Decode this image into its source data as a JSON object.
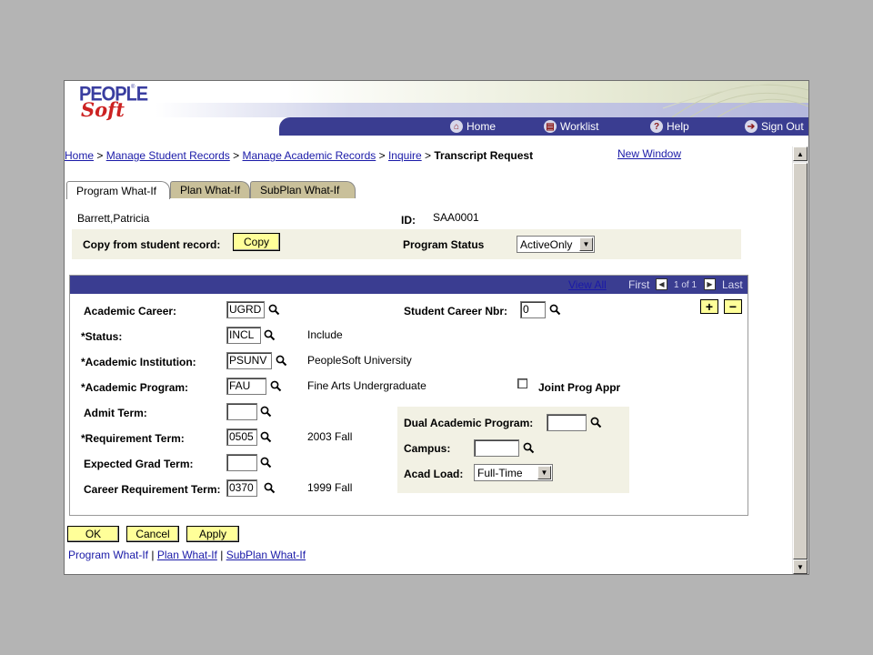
{
  "header": {
    "logo_text_1": "PEOPLE",
    "logo_text_2": "Soft",
    "nav": [
      {
        "label": "Home",
        "icon": "home-icon"
      },
      {
        "label": "Worklist",
        "icon": "worklist-icon"
      },
      {
        "label": "Help",
        "icon": "help-icon"
      },
      {
        "label": "Sign Out",
        "icon": "signout-icon"
      }
    ]
  },
  "breadcrumb": {
    "items": [
      "Home",
      "Manage Student Records",
      "Manage Academic Records",
      "Inquire"
    ],
    "separator": ">",
    "current": "Transcript Request"
  },
  "new_window": "New Window",
  "tabs": [
    "Program What-If",
    "Plan What-If",
    "SubPlan What-If"
  ],
  "student": {
    "name": "Barrett,Patricia",
    "id_label": "ID:",
    "id_value": "SAA0001"
  },
  "copy_bar": {
    "copy_label": "Copy from student record:",
    "copy_button": "Copy",
    "status_label": "Program Status",
    "status_value": "ActiveOnly"
  },
  "grid_header": {
    "view_all": "View All",
    "first": "First",
    "count": "1 of 1",
    "last": "Last"
  },
  "form": {
    "academic_career": {
      "label": "Academic Career:",
      "value": "UGRD"
    },
    "student_career_nbr": {
      "label": "Student Career Nbr:",
      "value": "0"
    },
    "status": {
      "label": "*Status:",
      "value": "INCL",
      "desc": "Include"
    },
    "academic_institution": {
      "label": "*Academic Institution:",
      "value": "PSUNV",
      "desc": "PeopleSoft University"
    },
    "academic_program": {
      "label": "*Academic Program:",
      "value": "FAU",
      "desc": "Fine Arts Undergraduate"
    },
    "joint_prog_appr": {
      "label": "Joint Prog Appr",
      "checked": false
    },
    "admit_term": {
      "label": "Admit Term:",
      "value": ""
    },
    "requirement_term": {
      "label": "*Requirement Term:",
      "value": "0505",
      "desc": "2003 Fall"
    },
    "expected_grad_term": {
      "label": "Expected Grad Term:",
      "value": ""
    },
    "career_requirement_term": {
      "label": "Career Requirement Term:",
      "value": "0370",
      "desc": "1999 Fall"
    },
    "dual_academic_program": {
      "label": "Dual Academic Program:",
      "value": ""
    },
    "campus": {
      "label": "Campus:",
      "value": ""
    },
    "acad_load": {
      "label": "Acad Load:",
      "value": "Full-Time"
    }
  },
  "buttons": {
    "ok": "OK",
    "cancel": "Cancel",
    "apply": "Apply"
  },
  "bottom_links": [
    "Program What-If",
    "Plan What-If",
    "SubPlan What-If"
  ],
  "colors": {
    "nav_bar": "#3a3d91",
    "yellow_button": "#ffff99",
    "tab_inactive": "#c9c09a",
    "panel_bg": "#f2f1e4"
  }
}
